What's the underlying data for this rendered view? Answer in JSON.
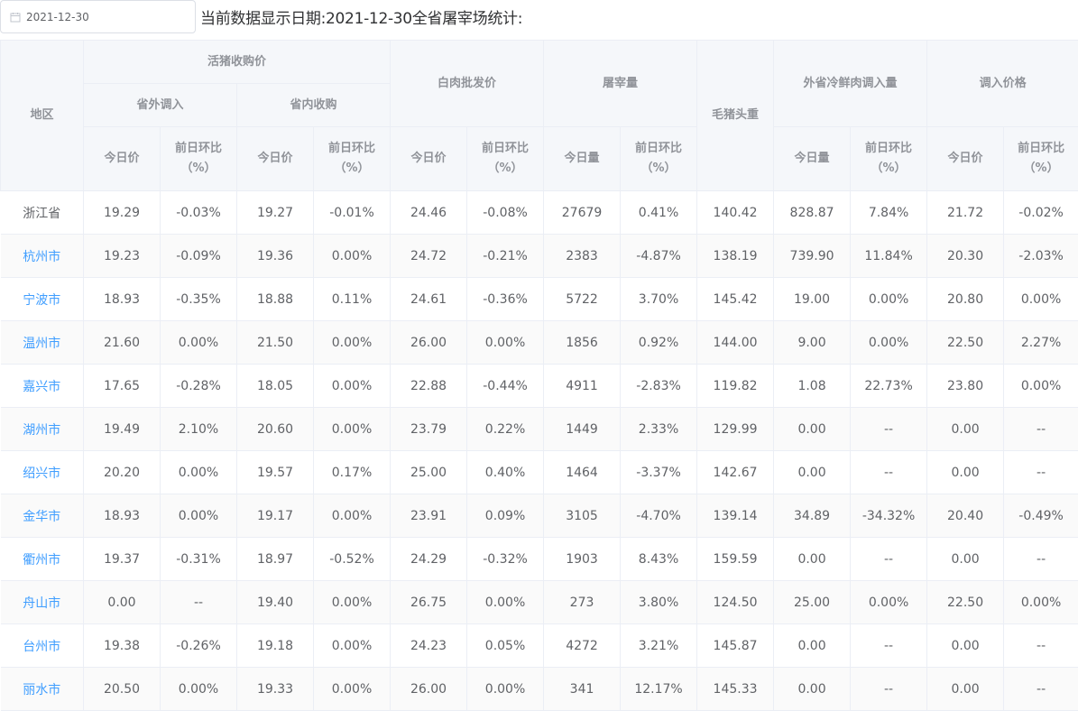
{
  "date_picker": {
    "value": "2021-12-30",
    "icon": "calendar-icon"
  },
  "summary_text": "当前数据显示日期:2021-12-30全省屠宰场统计:",
  "headers": {
    "region": "地区",
    "live_pig_price": "活猪收购价",
    "outside_province": "省外调入",
    "inside_province": "省内收购",
    "white_meat_price": "白肉批发价",
    "slaughter_volume": "屠宰量",
    "avg_weight": "毛猪头重",
    "chilled_meat_inflow": "外省冷鲜肉调入量",
    "inflow_price": "调入价格",
    "today_price": "今日价",
    "today_volume": "今日量",
    "prev_day_ratio": "前日环比（%）"
  },
  "rows": [
    {
      "region": "浙江省",
      "link": false,
      "c": [
        "19.29",
        "-0.03%",
        "19.27",
        "-0.01%",
        "24.46",
        "-0.08%",
        "27679",
        "0.41%",
        "140.42",
        "828.87",
        "7.84%",
        "21.72",
        "-0.02%"
      ]
    },
    {
      "region": "杭州市",
      "link": true,
      "c": [
        "19.23",
        "-0.09%",
        "19.36",
        "0.00%",
        "24.72",
        "-0.21%",
        "2383",
        "-4.87%",
        "138.19",
        "739.90",
        "11.84%",
        "20.30",
        "-2.03%"
      ]
    },
    {
      "region": "宁波市",
      "link": true,
      "c": [
        "18.93",
        "-0.35%",
        "18.88",
        "0.11%",
        "24.61",
        "-0.36%",
        "5722",
        "3.70%",
        "145.42",
        "19.00",
        "0.00%",
        "20.80",
        "0.00%"
      ]
    },
    {
      "region": "温州市",
      "link": true,
      "c": [
        "21.60",
        "0.00%",
        "21.50",
        "0.00%",
        "26.00",
        "0.00%",
        "1856",
        "0.92%",
        "144.00",
        "9.00",
        "0.00%",
        "22.50",
        "2.27%"
      ]
    },
    {
      "region": "嘉兴市",
      "link": true,
      "c": [
        "17.65",
        "-0.28%",
        "18.05",
        "0.00%",
        "22.88",
        "-0.44%",
        "4911",
        "-2.83%",
        "119.82",
        "1.08",
        "22.73%",
        "23.80",
        "0.00%"
      ]
    },
    {
      "region": "湖州市",
      "link": true,
      "c": [
        "19.49",
        "2.10%",
        "20.60",
        "0.00%",
        "23.79",
        "0.22%",
        "1449",
        "2.33%",
        "129.99",
        "0.00",
        "--",
        "0.00",
        "--"
      ]
    },
    {
      "region": "绍兴市",
      "link": true,
      "c": [
        "20.20",
        "0.00%",
        "19.57",
        "0.17%",
        "25.00",
        "0.40%",
        "1464",
        "-3.37%",
        "142.67",
        "0.00",
        "--",
        "0.00",
        "--"
      ]
    },
    {
      "region": "金华市",
      "link": true,
      "c": [
        "18.93",
        "0.00%",
        "19.17",
        "0.00%",
        "23.91",
        "0.09%",
        "3105",
        "-4.70%",
        "139.14",
        "34.89",
        "-34.32%",
        "20.40",
        "-0.49%"
      ]
    },
    {
      "region": "衢州市",
      "link": true,
      "c": [
        "19.37",
        "-0.31%",
        "18.97",
        "-0.52%",
        "24.29",
        "-0.32%",
        "1903",
        "8.43%",
        "159.59",
        "0.00",
        "--",
        "0.00",
        "--"
      ]
    },
    {
      "region": "舟山市",
      "link": true,
      "c": [
        "0.00",
        "--",
        "19.40",
        "0.00%",
        "26.75",
        "0.00%",
        "273",
        "3.80%",
        "124.50",
        "25.00",
        "0.00%",
        "22.50",
        "0.00%"
      ]
    },
    {
      "region": "台州市",
      "link": true,
      "c": [
        "19.38",
        "-0.26%",
        "19.18",
        "0.00%",
        "24.23",
        "0.05%",
        "4272",
        "3.21%",
        "145.87",
        "0.00",
        "--",
        "0.00",
        "--"
      ]
    },
    {
      "region": "丽水市",
      "link": true,
      "c": [
        "20.50",
        "0.00%",
        "19.33",
        "0.00%",
        "26.00",
        "0.00%",
        "341",
        "12.17%",
        "145.33",
        "0.00",
        "--",
        "0.00",
        "--"
      ]
    }
  ],
  "colors": {
    "link": "#409eff",
    "header_bg": "#f5f7fa",
    "border": "#ebeef5",
    "text": "#606266"
  }
}
